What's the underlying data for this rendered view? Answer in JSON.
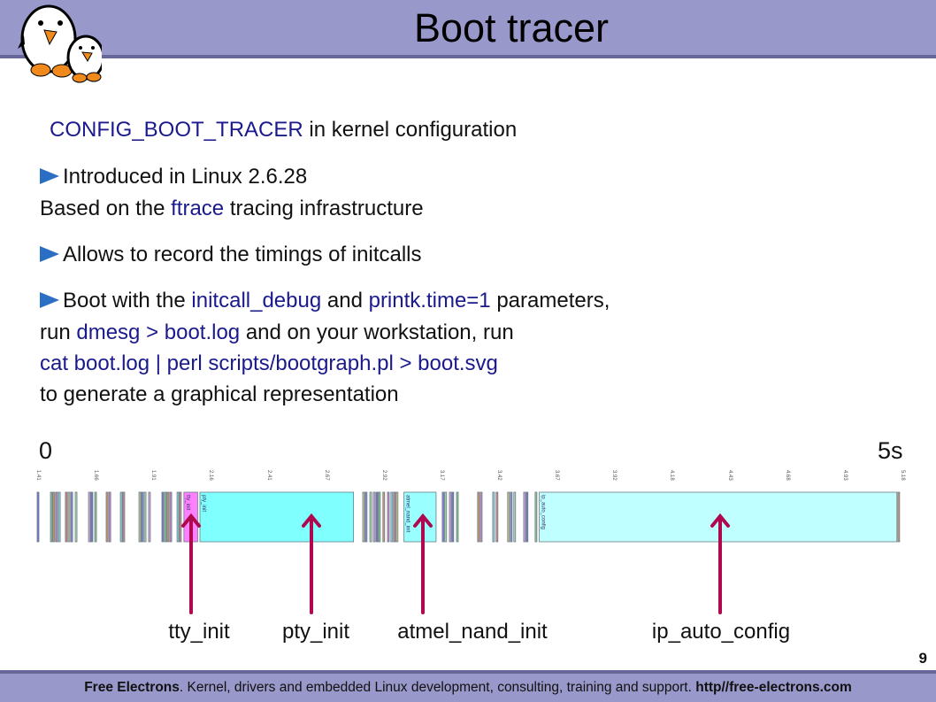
{
  "slide": {
    "title": "Boot tracer",
    "page_number": "9"
  },
  "content": {
    "line1": {
      "kw": "CONFIG_BOOT_TRACER",
      "rest": " in kernel configuration"
    },
    "bullet1": {
      "a": "Introduced in Linux 2.6.28"
    },
    "line2": {
      "a": "Based on the ",
      "kw": "ftrace",
      "b": " tracing infrastructure"
    },
    "bullet2": {
      "a": "Allows to record the timings of initcalls"
    },
    "bullet3": {
      "a": "Boot with the ",
      "kw1": "initcall_debug",
      "b": " and ",
      "kw2": "printk.time=1",
      "c": " parameters,"
    },
    "line3": {
      "a": "run ",
      "kw": "dmesg > boot.log",
      "b": " and on your workstation, run"
    },
    "line4": {
      "kw": "cat boot.log | perl scripts/bootgraph.pl > boot.svg"
    },
    "line5": {
      "a": "to generate a graphical representation"
    }
  },
  "timeline": {
    "start_label": "0",
    "end_label": "5s",
    "ticks": [
      "1.41",
      "1.66",
      "1.91",
      "2.16",
      "2.41",
      "2.67",
      "2.92",
      "3.17",
      "3.42",
      "3.67",
      "3.92",
      "4.18",
      "4.43",
      "4.68",
      "4.93",
      "5.18"
    ],
    "range_s": [
      1.41,
      5.18
    ],
    "blocks": [
      {
        "name": "tty_init",
        "start": 2.05,
        "end": 2.11,
        "color": "#ff80ff"
      },
      {
        "name": "pty_init",
        "start": 2.12,
        "end": 2.79,
        "color": "#80ffff"
      },
      {
        "name": "atmel_nand_init",
        "start": 3.01,
        "end": 3.15,
        "color": "#99ffff"
      },
      {
        "name": "ip_auto_config",
        "start": 3.6,
        "end": 5.16,
        "color": "#c0ffff"
      }
    ],
    "short_calls": [
      1.41,
      1.468,
      1.479,
      1.491,
      1.503,
      1.533,
      1.545,
      1.557,
      1.576,
      1.634,
      1.645,
      1.661,
      1.711,
      1.723,
      1.773,
      1.784,
      1.854,
      1.865,
      1.877,
      1.896,
      1.954,
      1.966,
      1.977,
      1.989,
      2.02,
      2.031,
      2.83,
      2.841,
      2.861,
      2.876,
      2.888,
      2.899,
      2.918,
      2.938,
      2.953,
      2.965,
      2.976,
      3.177,
      3.188,
      3.208,
      3.219,
      3.239,
      3.331,
      3.343,
      3.397,
      3.412,
      3.462,
      3.474,
      3.489,
      3.532,
      3.543,
      3.582,
      5.164
    ],
    "short_call_colors": [
      "#7777cc",
      "#88cc88",
      "#dd9966",
      "#cc88cc",
      "#88dddd",
      "#dd8888",
      "#cccc88",
      "#8888dd",
      "#aaddaa",
      "#ddaadd"
    ],
    "callouts": [
      "tty_init",
      "pty_init",
      "atmel_nand_init",
      "ip_auto_config"
    ],
    "arrow_color": "#b0084f"
  },
  "footer": {
    "brand": "Free Electrons",
    "text": ". Kernel, drivers and embedded Linux development, consulting, training and support. ",
    "url": "http//free-electrons.com"
  },
  "colors": {
    "header": "#9898ca",
    "header_border": "#676799",
    "keyword": "#1a1a8c",
    "bullet": "#2a6fc4"
  }
}
